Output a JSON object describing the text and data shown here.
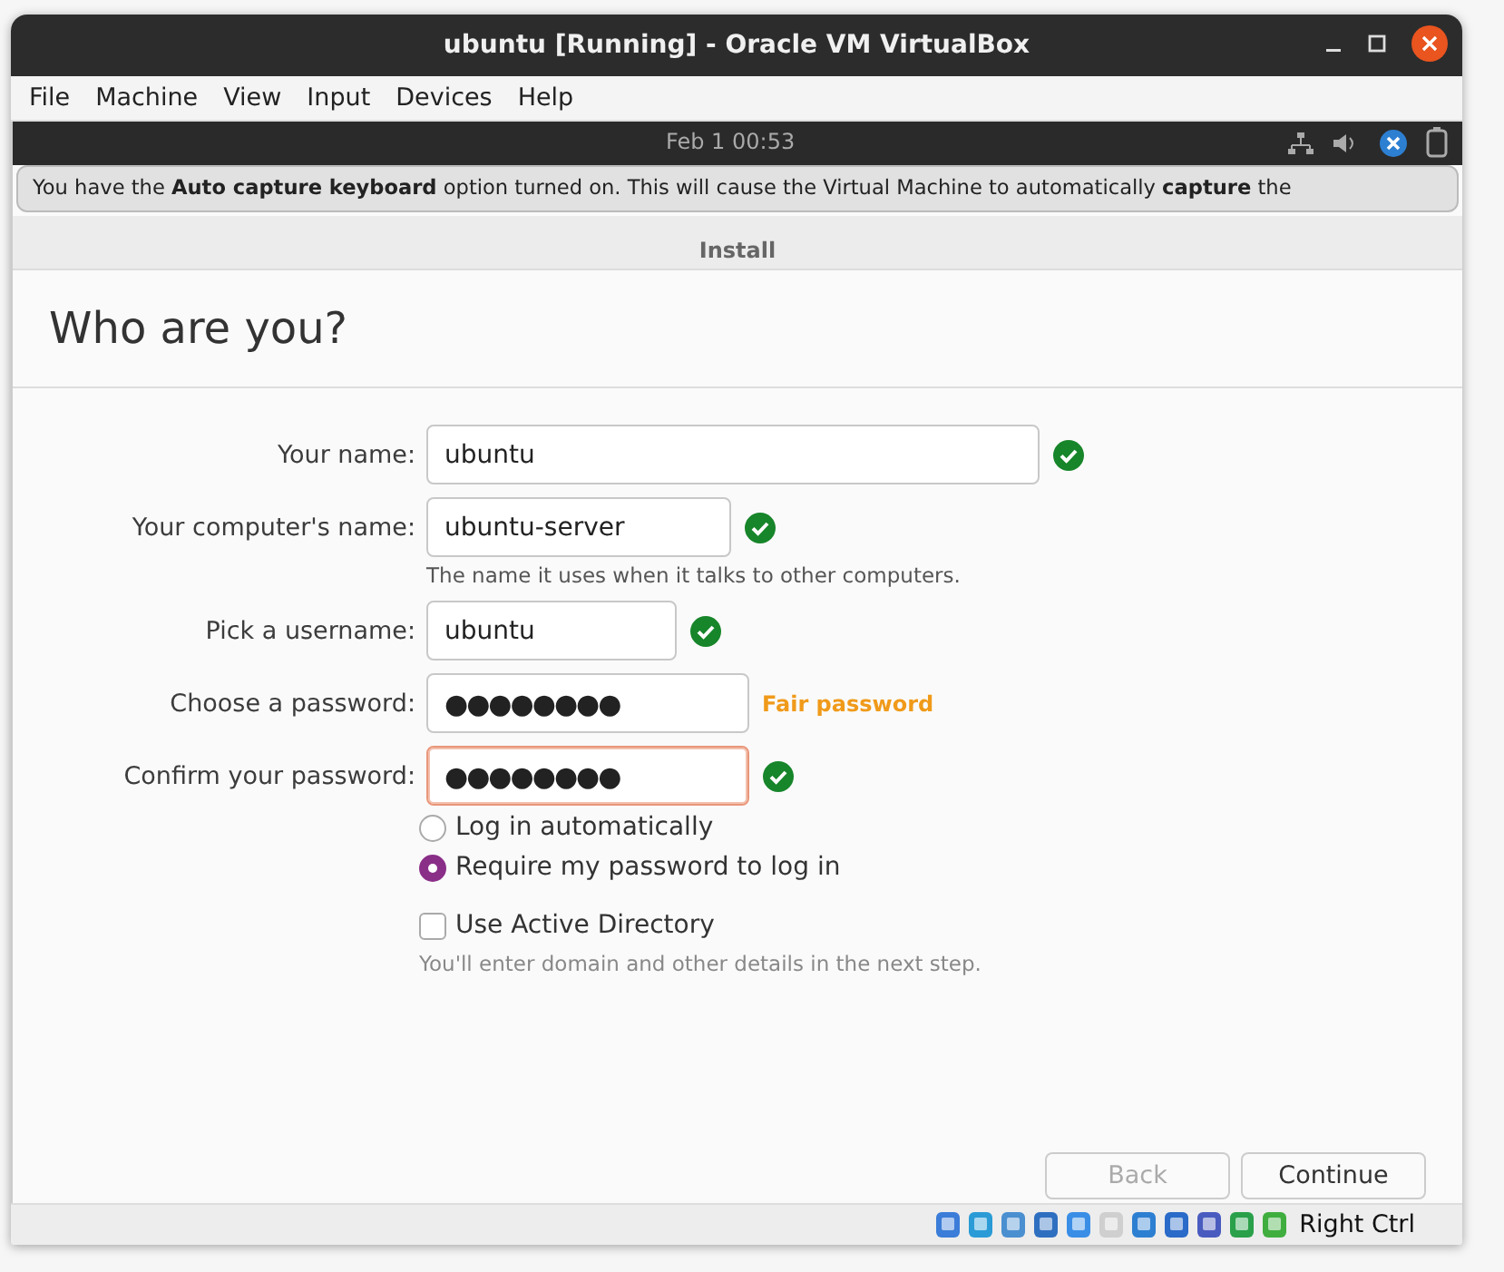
{
  "window": {
    "title": "ubuntu [Running] - Oracle VM VirtualBox"
  },
  "menu": [
    "File",
    "Machine",
    "View",
    "Input",
    "Devices",
    "Help"
  ],
  "notice": {
    "text": "You have the **Auto capture keyboard** option turned on. This will cause the Virtual Machine to automatically **capture** the",
    "clock": "Feb 1  00:53"
  },
  "installer": {
    "title": "Install",
    "heading": "Who are you?",
    "fields": [
      {
        "label": "Your name:",
        "value": "ubuntu",
        "kind": "text",
        "valid": true,
        "focused": false
      },
      {
        "label": "Your computer's name:",
        "value": "ubuntu-server",
        "kind": "text",
        "valid": true,
        "focused": false,
        "hint": "The name it uses when it talks to other computers."
      },
      {
        "label": "Pick a username:",
        "value": "ubuntu",
        "kind": "text",
        "valid": true,
        "focused": false
      },
      {
        "label": "Choose a password:",
        "value": "●●●●●●●●",
        "kind": "password",
        "valid": false,
        "focused": false,
        "strength": "Fair password"
      },
      {
        "label": "Confirm your password:",
        "value": "●●●●●●●●",
        "kind": "password",
        "valid": true,
        "focused": true
      }
    ],
    "login_options": [
      {
        "label": "Log in automatically",
        "selected": false
      },
      {
        "label": "Require my password to log in",
        "selected": true
      }
    ],
    "active_directory": {
      "label": "Use Active Directory",
      "checked": false,
      "hint": "You'll enter domain and other details in the next step."
    },
    "buttons": [
      {
        "label": "Back",
        "disabled": true
      },
      {
        "label": "Continue",
        "disabled": false
      }
    ]
  },
  "status_bar": {
    "host_key": "Right Ctrl"
  }
}
